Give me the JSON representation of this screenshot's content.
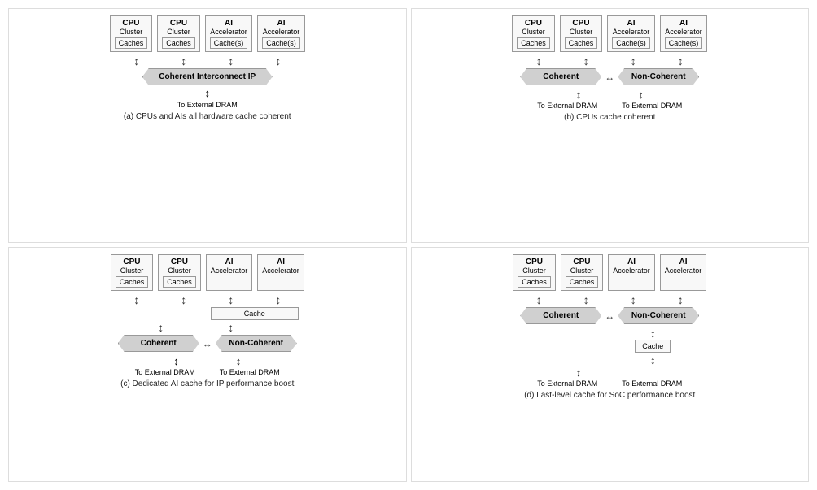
{
  "diagrams": [
    {
      "id": "a",
      "caption": "(a) CPUs and AIs all hardware cache coherent",
      "units": [
        {
          "title": "CPU",
          "subtitle": "Cluster",
          "cache": "Caches"
        },
        {
          "title": "CPU",
          "subtitle": "Cluster",
          "cache": "Caches"
        },
        {
          "title": "AI",
          "subtitle": "Accelerator",
          "cache": "Cache(s)"
        },
        {
          "title": "AI",
          "subtitle": "Accelerator",
          "cache": "Cache(s)"
        }
      ],
      "banner_type": "single",
      "banner_label": "Coherent Interconnect IP",
      "dram_labels": [
        "To External DRAM"
      ]
    },
    {
      "id": "b",
      "caption": "(b) CPUs cache coherent",
      "units": [
        {
          "title": "CPU",
          "subtitle": "Cluster",
          "cache": "Caches"
        },
        {
          "title": "CPU",
          "subtitle": "Cluster",
          "cache": "Caches"
        },
        {
          "title": "AI",
          "subtitle": "Accelerator",
          "cache": "Cache(s)"
        },
        {
          "title": "AI",
          "subtitle": "Accelerator",
          "cache": "Cache(s)"
        }
      ],
      "banner_type": "double",
      "banner_left": "Coherent",
      "banner_right": "Non-Coherent",
      "dram_labels": [
        "To External DRAM",
        "To External DRAM"
      ]
    },
    {
      "id": "c",
      "caption": "(c) Dedicated AI cache for IP performance boost",
      "units": [
        {
          "title": "CPU",
          "subtitle": "Cluster",
          "cache": "Caches"
        },
        {
          "title": "CPU",
          "subtitle": "Cluster",
          "cache": "Caches"
        },
        {
          "title": "AI",
          "subtitle": "Accelerator",
          "cache": ""
        },
        {
          "title": "AI",
          "subtitle": "Accelerator",
          "cache": ""
        }
      ],
      "banner_type": "double_with_cache",
      "banner_left": "Coherent",
      "banner_right": "Non-Coherent",
      "ai_cache_label": "Cache",
      "dram_labels": [
        "To External DRAM",
        "To External DRAM"
      ]
    },
    {
      "id": "d",
      "caption": "(d) Last-level cache for SoC performance boost",
      "units": [
        {
          "title": "CPU",
          "subtitle": "Cluster",
          "cache": "Caches"
        },
        {
          "title": "CPU",
          "subtitle": "Cluster",
          "cache": "Caches"
        },
        {
          "title": "AI",
          "subtitle": "Accelerator",
          "cache": ""
        },
        {
          "title": "AI",
          "subtitle": "Accelerator",
          "cache": ""
        }
      ],
      "banner_type": "double_with_bottom_cache",
      "banner_left": "Coherent",
      "banner_right": "Non-Coherent",
      "bottom_cache_label": "Cache",
      "dram_labels": [
        "To External DRAM",
        "To External DRAM"
      ]
    }
  ]
}
